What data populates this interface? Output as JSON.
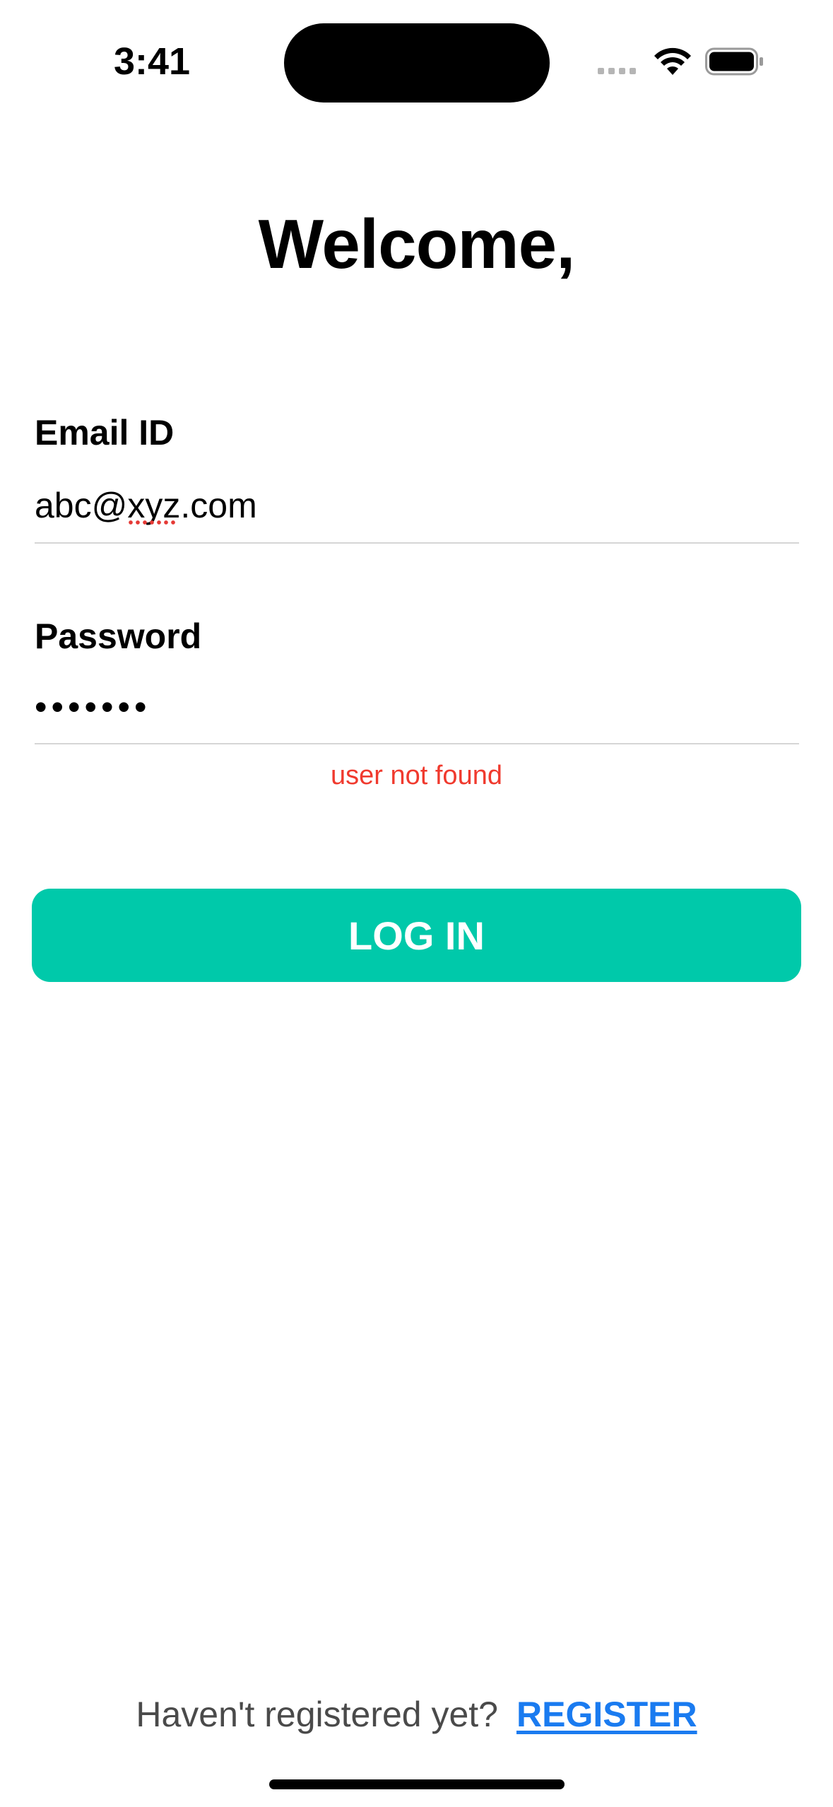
{
  "status_bar": {
    "time": "3:41",
    "icons": [
      "cellular-signal-icon",
      "wifi-icon",
      "battery-icon"
    ]
  },
  "title": "Welcome,",
  "form": {
    "email_label": "Email ID",
    "email_value": "abc@xyz.com",
    "password_label": "Password",
    "password_value": "•••••••",
    "error_message": "user not found"
  },
  "login_button": {
    "label": "LOG IN"
  },
  "footer": {
    "prompt": "Haven't registered yet?",
    "register_label": "REGISTER"
  },
  "colors": {
    "accent": "#00c9aa",
    "error": "#f03a2e",
    "link": "#1a7bf0",
    "divider": "#d6d6d6"
  }
}
